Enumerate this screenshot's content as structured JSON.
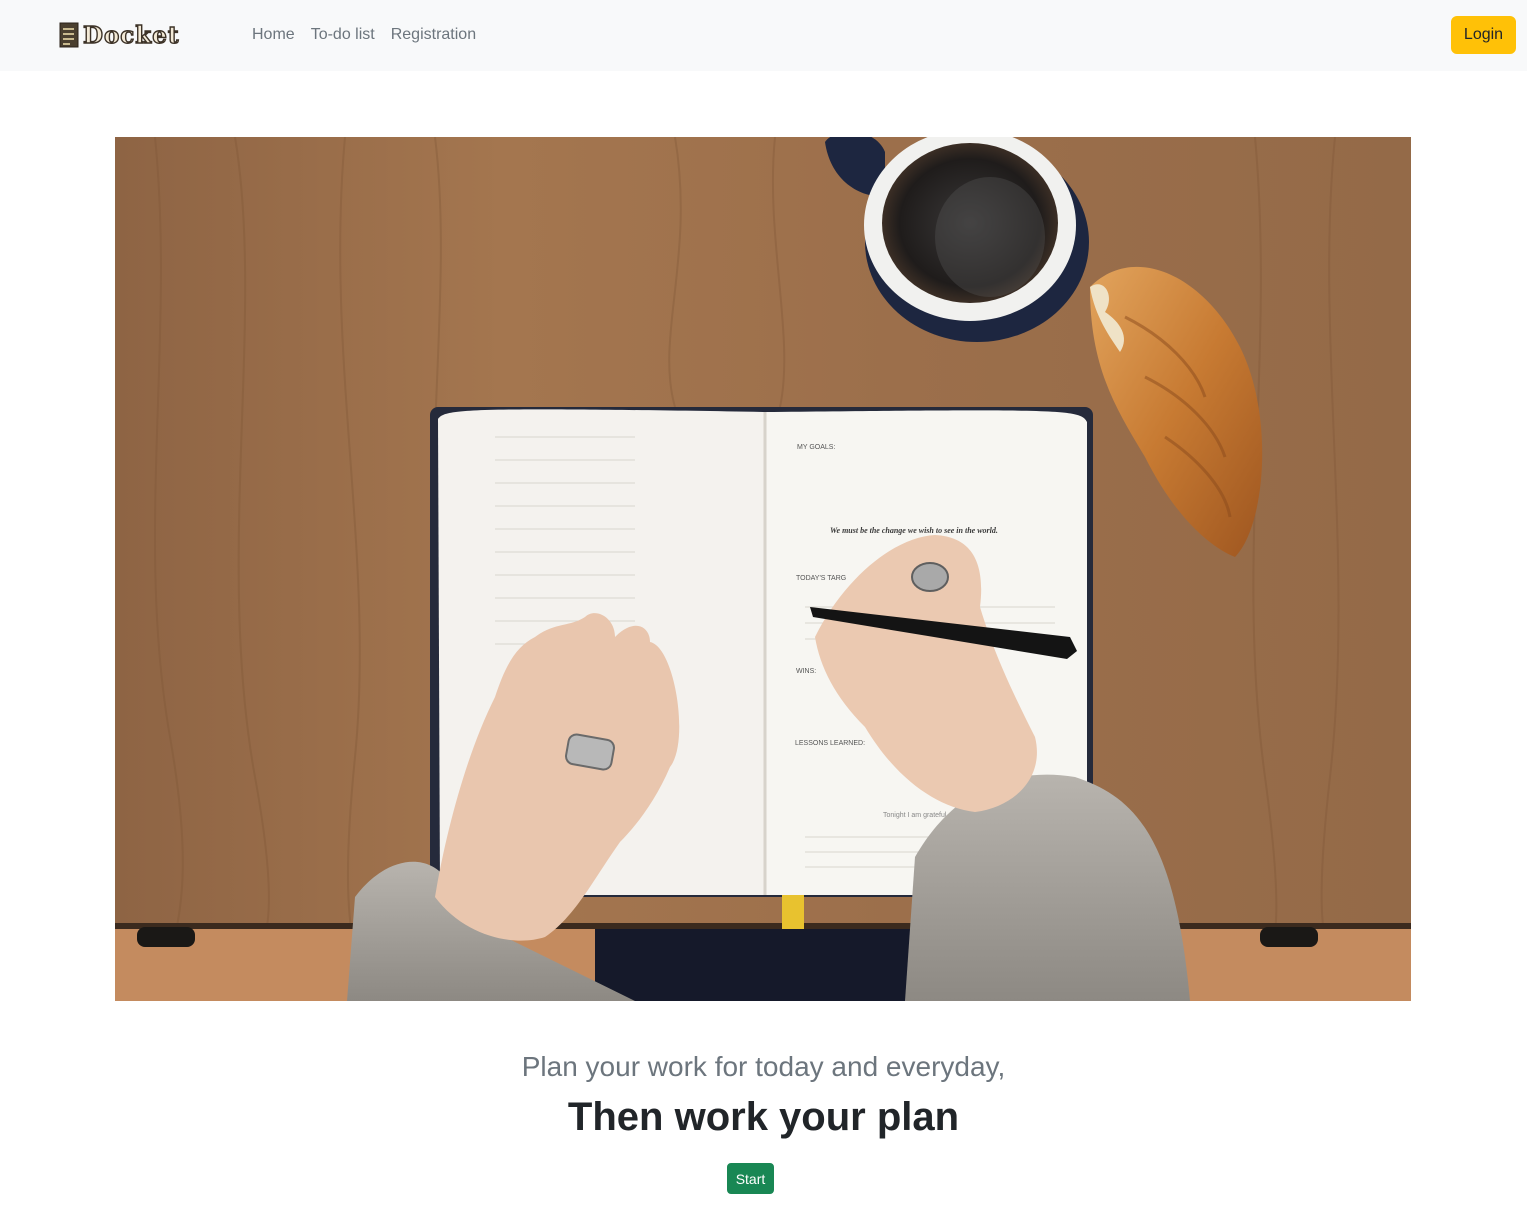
{
  "navbar": {
    "brand": "Docket",
    "links": [
      {
        "label": "Home"
      },
      {
        "label": "To-do list"
      },
      {
        "label": "Registration"
      }
    ],
    "login_label": "Login"
  },
  "hero": {
    "journal_text": {
      "my_goals": "MY GOALS:",
      "quote": "We must be the change we wish to see in the world.",
      "todays_targets": "TODAY'S TARG",
      "wins": "WINS:",
      "lessons": "LESSONS LEARNED:",
      "grateful": "Tonight I am grateful"
    }
  },
  "main": {
    "tagline": "Plan your work for today and everyday,",
    "headline": "Then work your plan",
    "start_label": "Start"
  },
  "colors": {
    "navbar_bg": "#f8f9fa",
    "login": "#ffc107",
    "start": "#198754",
    "muted": "#6c757d"
  }
}
